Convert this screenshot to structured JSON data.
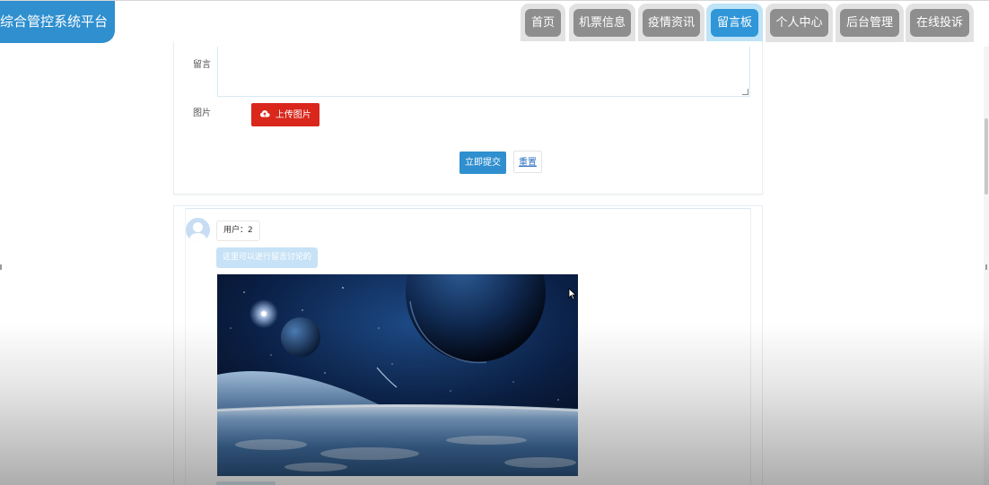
{
  "header": {
    "title": "综合管控系统平台",
    "nav": [
      {
        "label": "首页",
        "active": false
      },
      {
        "label": "机票信息",
        "active": false
      },
      {
        "label": "疫情资讯",
        "active": false
      },
      {
        "label": "留言板",
        "active": true
      },
      {
        "label": "个人中心",
        "active": false
      },
      {
        "label": "后台管理",
        "active": false
      },
      {
        "label": "在线投诉",
        "active": false
      }
    ]
  },
  "form": {
    "message_label": "留言",
    "message_value": "",
    "image_label": "图片",
    "upload_label": "上传图片",
    "submit_label": "立即提交",
    "reset_label": "重置"
  },
  "comments": [
    {
      "user": "用户：2",
      "text": "这里可以进行留言讨论的",
      "image": "space-planets-image"
    }
  ],
  "colors": {
    "primary": "#2f8fcf",
    "upload": "#d9271c",
    "nav_inactive": "#8e8e8e",
    "nav_active": "#2f96d8"
  }
}
